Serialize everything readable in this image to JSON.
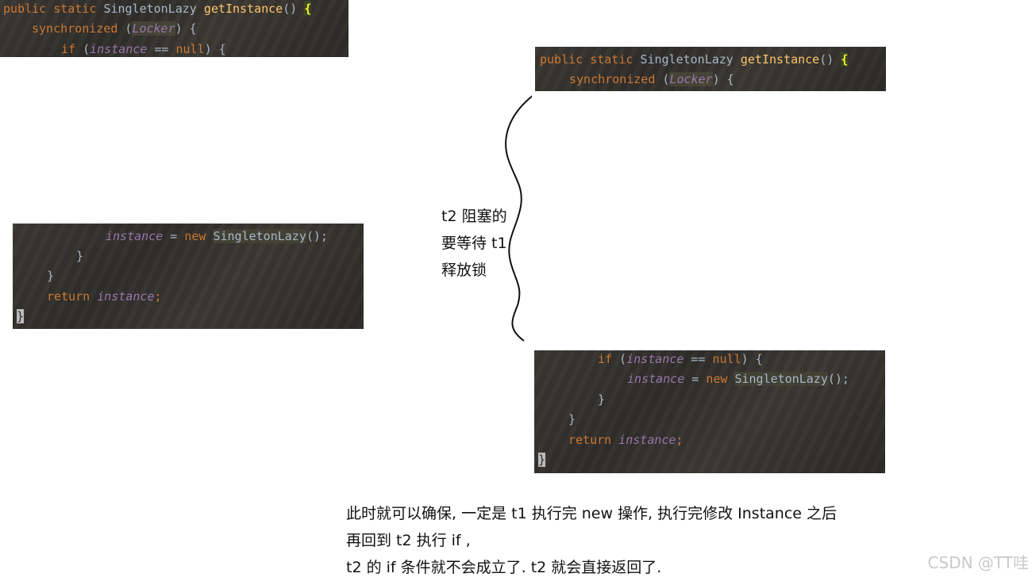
{
  "code_top_left": {
    "l1": {
      "kw1": "public static ",
      "cls": "SingletonLazy ",
      "fn": "getInstance",
      "paren": "() ",
      "brace": "{"
    },
    "l2": {
      "kw": "synchronized ",
      "open": "(",
      "locker": "Locker",
      "close": ") {"
    },
    "l3": {
      "kw": "if ",
      "open": "(",
      "var": "instance",
      "rest": " == ",
      "kw2": "null",
      "close": ") {"
    }
  },
  "code_mid_left": {
    "l1": {
      "var": "instance",
      "eq": " = ",
      "kw": "new ",
      "cls": "SingletonLazy",
      "end": "();"
    },
    "l2": "}",
    "l3": "}",
    "l4": {
      "kw": "return ",
      "var": "instance",
      "semi": ";"
    },
    "l5": "}"
  },
  "code_top_right": {
    "l1": {
      "kw1": "public static ",
      "cls": "SingletonLazy ",
      "fn": "getInstance",
      "paren": "() ",
      "brace": "{"
    },
    "l2": {
      "kw": "synchronized ",
      "open": "(",
      "locker": "Locker",
      "close": ") {"
    }
  },
  "code_bottom_right": {
    "l1": {
      "kw": "if ",
      "open": "(",
      "var": "instance",
      "rest": " == ",
      "kw2": "null",
      "close": ") {"
    },
    "l2": {
      "var": "instance",
      "eq": " = ",
      "kw": "new ",
      "cls": "SingletonLazy",
      "end": "();"
    },
    "l3": "}",
    "l4": "}",
    "l5": {
      "kw": "return ",
      "var": "instance",
      "semi": ";"
    },
    "l6": "}"
  },
  "notes": {
    "t2_lines": [
      "t2 阻塞的",
      "要等待 t1",
      "释放锁"
    ],
    "bottom_lines": [
      "此时就可以确保, 一定是 t1 执行完 new 操作, 执行完修改 Instance 之后",
      "再回到 t2 执行 if ,",
      "t2 的 if 条件就不会成立了. t2 就会直接返回了."
    ]
  },
  "watermark": "CSDN @TT哇"
}
